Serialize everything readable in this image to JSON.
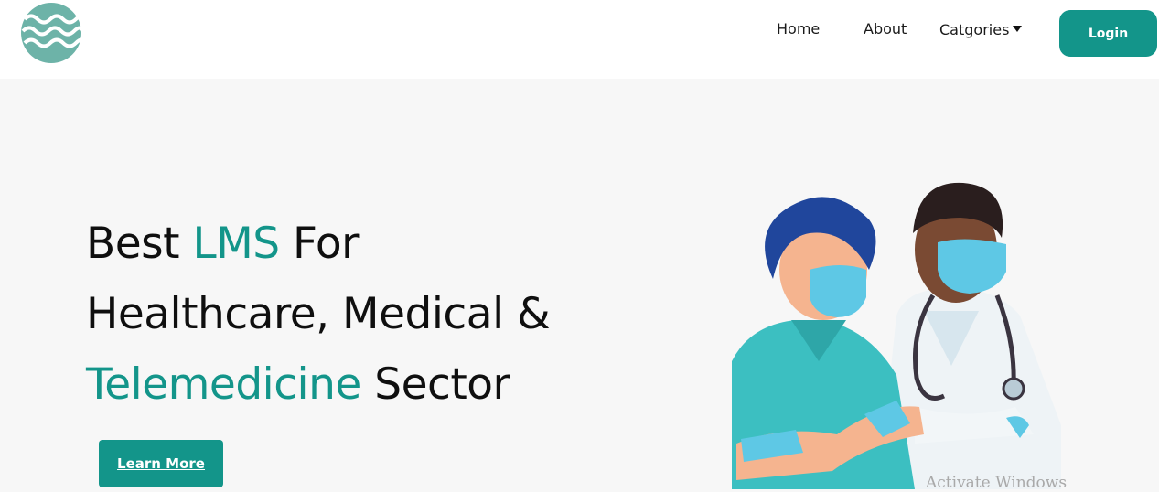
{
  "nav": {
    "logo_icon": "waves-logo-icon",
    "links": [
      "Home",
      "About",
      "Catgories"
    ],
    "login_label": "Login"
  },
  "hero": {
    "line1_a": "Best ",
    "line1_accent": "LMS",
    "line1_b": " For",
    "line2": "Healthcare, Medical &",
    "line3_accent": "Telemedicine",
    "line3_b": " Sector",
    "cta_label": "Learn More",
    "illustration": "doctor-and-nurse-illustration"
  },
  "system": {
    "watermark": "Activate Windows"
  },
  "colors": {
    "accent": "#13958a",
    "logo": "#6db3a8",
    "background": "#f7f7f7"
  }
}
